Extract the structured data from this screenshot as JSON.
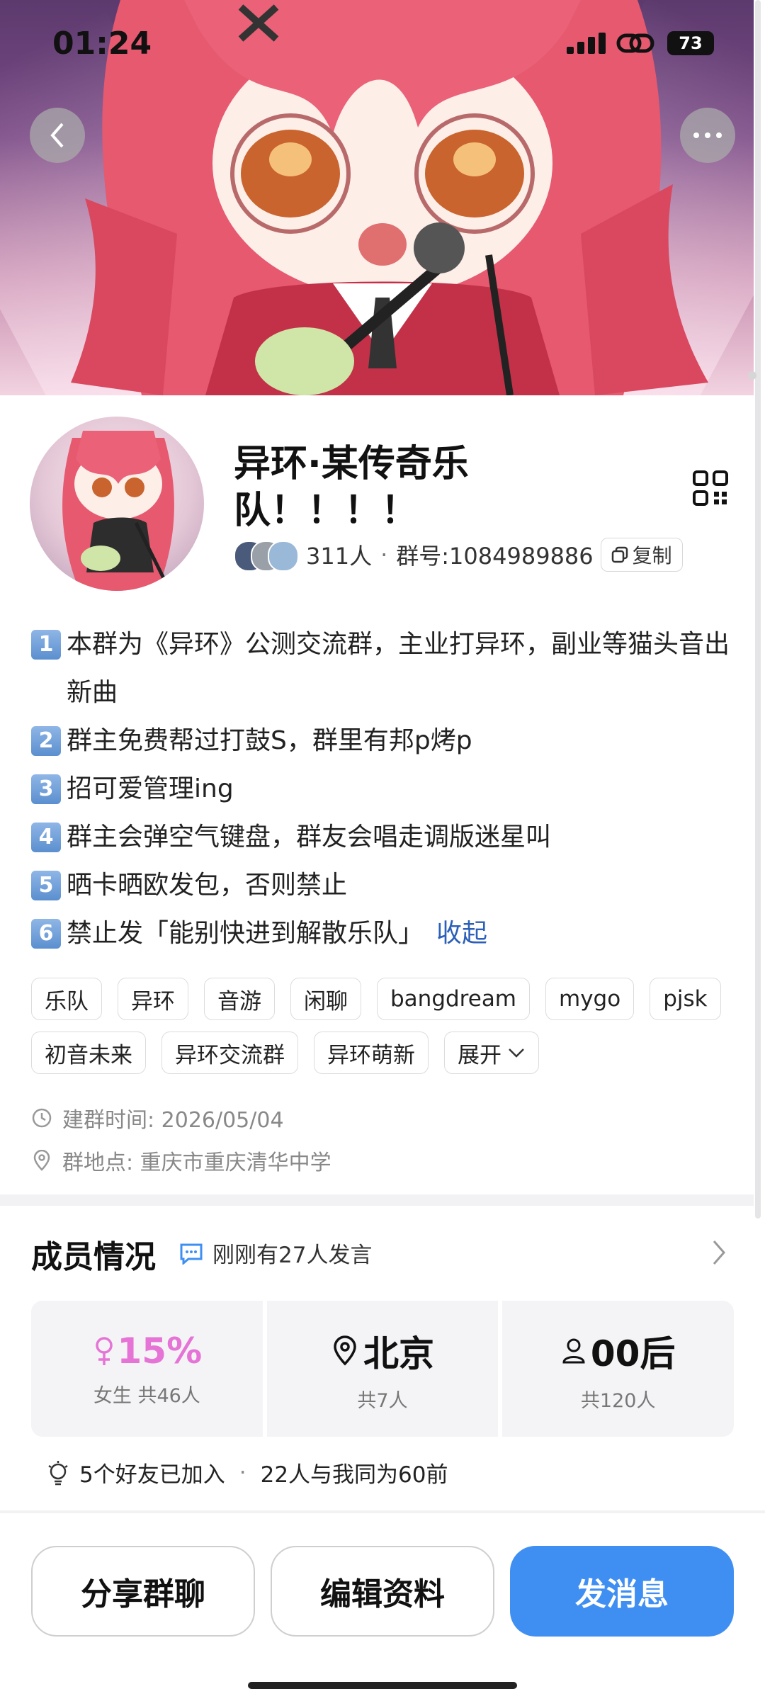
{
  "status_bar": {
    "time": "01:24",
    "battery": "73"
  },
  "group": {
    "name": "异环·某传奇乐队！！！！",
    "member_count": "311人",
    "dot": "·",
    "group_number": "群号:1084989886",
    "copy_label": "复制"
  },
  "description": [
    {
      "num": "1",
      "text": "本群为《异环》公测交流群，主业打异环，副业等猫头音出新曲"
    },
    {
      "num": "2",
      "text": "群主免费帮过打鼓S，群里有邦p烤p"
    },
    {
      "num": "3",
      "text": "招可爱管理ing"
    },
    {
      "num": "4",
      "text": "群主会弹空气键盘，群友会唱走调版迷星叫"
    },
    {
      "num": "5",
      "text": "晒卡晒欧发包，否则禁止"
    },
    {
      "num": "6",
      "text": "禁止发「能别快进到解散乐队」"
    }
  ],
  "collapse_label": "收起",
  "tags": [
    "乐队",
    "异环",
    "音游",
    "闲聊",
    "bangdream",
    "mygo",
    "pjsk",
    "初音未来",
    "异环交流群",
    "异环萌新"
  ],
  "expand_label": "展开",
  "created": "建群时间: 2026/05/04",
  "location": "群地点: 重庆市重庆清华中学",
  "members": {
    "title": "成员情况",
    "recent": "刚刚有27人发言",
    "stats": [
      {
        "value": "15%",
        "label": "女生 共46人"
      },
      {
        "value": "北京",
        "label": "共7人"
      },
      {
        "value": "00后",
        "label": "共120人"
      }
    ],
    "friends": "5个好友已加入",
    "sep": "·",
    "same_age": "22人与我同为60前"
  },
  "buttons": {
    "share": "分享群聊",
    "edit": "编辑资料",
    "send": "发消息"
  },
  "colors": {
    "accent": "#3f8ff3",
    "link": "#2c5fb8",
    "female": "#e574d6"
  }
}
